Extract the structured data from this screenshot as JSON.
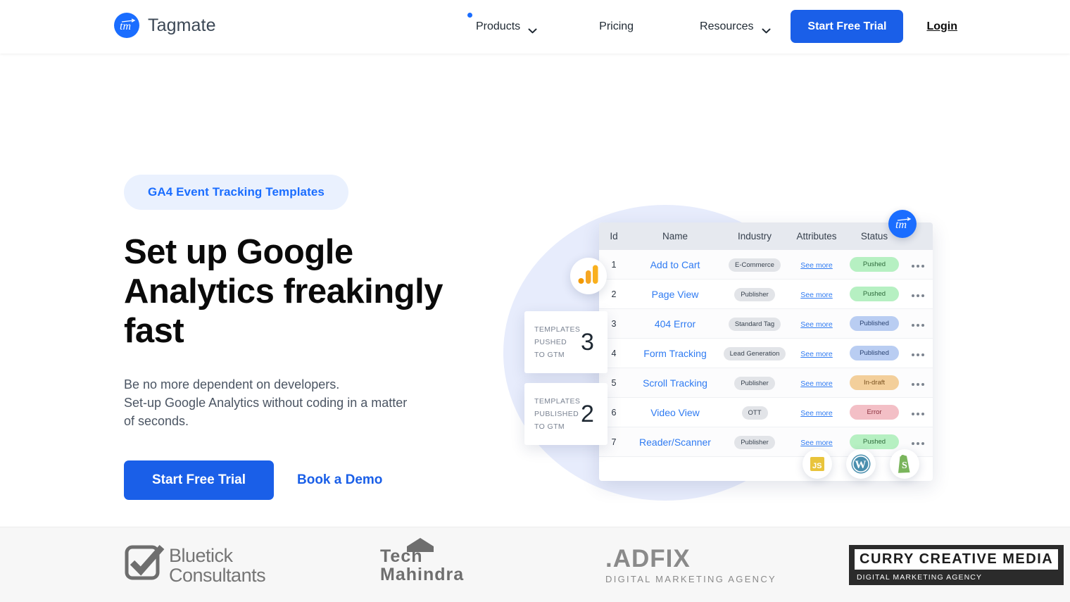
{
  "header": {
    "brand_name": "Tagmate",
    "brand_icon": "tm-logo-icon",
    "nav": [
      {
        "label": "Products",
        "has_chevron": true,
        "has_dot": true
      },
      {
        "label": "Pricing",
        "has_chevron": false,
        "has_dot": false
      },
      {
        "label": "Resources",
        "has_chevron": true,
        "has_dot": false
      }
    ],
    "cta_label": "Start Free Trial",
    "login_label": "Login"
  },
  "hero": {
    "badge": "GA4 Event Tracking Templates",
    "title": "Set up Google Analytics freakingly fast",
    "subtitle": "Be no more dependent on developers.\nSet-up Google Analytics without coding in a matter of seconds.",
    "subtitle_line1": "Be no more dependent on developers.",
    "subtitle_line2": "Set-up Google Analytics without coding in a matter",
    "subtitle_line3": "of seconds.",
    "cta_primary": "Start Free Trial",
    "cta_secondary": "Book a Demo"
  },
  "illustration": {
    "ga_icon": "google-analytics-icon",
    "tm_icon": "tm-logo-icon",
    "stats": [
      {
        "label": "Templates pushed to GTM",
        "value": "3"
      },
      {
        "label": "Templates published to GTM",
        "value": "2"
      }
    ],
    "table": {
      "columns": [
        "Id",
        "Name",
        "Industry",
        "Attributes",
        "Status",
        ""
      ],
      "rows": [
        {
          "id": "1",
          "name": "Add to Cart",
          "industry": "E-Commerce",
          "attributes": "See more",
          "status": "Pushed",
          "status_kind": "pushed"
        },
        {
          "id": "2",
          "name": "Page View",
          "industry": "Publisher",
          "attributes": "See more",
          "status": "Pushed",
          "status_kind": "pushed"
        },
        {
          "id": "3",
          "name": "404 Error",
          "industry": "Standard Tag",
          "attributes": "See more",
          "status": "Published",
          "status_kind": "published"
        },
        {
          "id": "4",
          "name": "Form Tracking",
          "industry": "Lead Generation",
          "attributes": "See more",
          "status": "Published",
          "status_kind": "published"
        },
        {
          "id": "5",
          "name": "Scroll Tracking",
          "industry": "Publisher",
          "attributes": "See more",
          "status": "In-draft",
          "status_kind": "indraft"
        },
        {
          "id": "6",
          "name": "Video View",
          "industry": "OTT",
          "attributes": "See more",
          "status": "Error",
          "status_kind": "error"
        },
        {
          "id": "7",
          "name": "Reader/Scanner",
          "industry": "Publisher",
          "attributes": "See more",
          "status": "Pushed",
          "status_kind": "pushed"
        }
      ]
    },
    "tech_badges": [
      "javascript-icon",
      "wordpress-icon",
      "shopify-icon"
    ]
  },
  "logos": [
    {
      "name": "Bluetick Consultants",
      "line1": "Bluetick",
      "line2": "Consultants"
    },
    {
      "name": "Tech Mahindra",
      "line1": "Tech",
      "line2": "Mahindra"
    },
    {
      "name": "ADFIX Digital Marketing Agency",
      "line1": ".ADFIX",
      "line2": "DIGITAL MARKETING AGENCY"
    },
    {
      "name": "Curry Creative Media",
      "line1": "CURRY CREATIVE MEDIA",
      "line2": "DIGITAL MARKETING AGENCY"
    }
  ],
  "colors": {
    "brand_blue": "#1a6dff",
    "button_blue": "#1a5fe8",
    "badge_bg": "#eaf1fe",
    "blob": "#dfe6fb",
    "status_pushed": "#b6f0c2",
    "status_published": "#b9cdf2",
    "status_indraft": "#f3cf9b",
    "status_error": "#f3bfc6"
  }
}
